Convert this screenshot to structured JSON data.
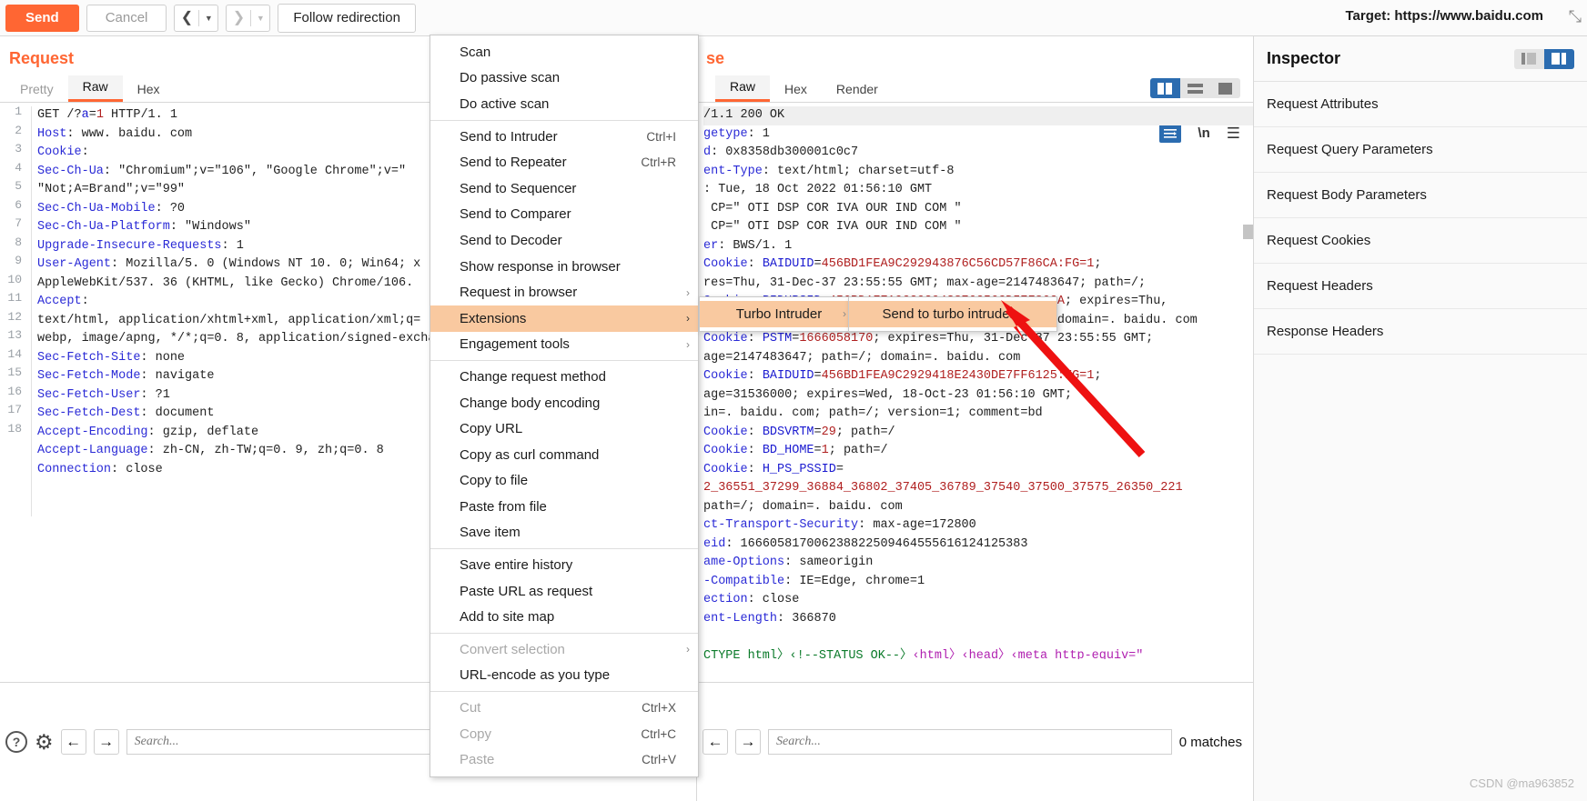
{
  "toolbar": {
    "send_label": "Send",
    "cancel_label": "Cancel",
    "back_arrow": "❮",
    "forward_arrow": "❯",
    "caret": "▼",
    "follow_redirection_label": "Follow redirection",
    "target_label": "Target: https://www.baidu.com",
    "corner_glyph": "⤡"
  },
  "request": {
    "title": "Request",
    "tabs": [
      {
        "label": "Pretty",
        "active": false,
        "muted": true
      },
      {
        "label": "Raw",
        "active": true,
        "muted": false
      },
      {
        "label": "Hex",
        "active": false,
        "muted": false
      }
    ],
    "line_numbers": [
      "1",
      "2",
      "3",
      "4",
      "",
      "5",
      "6",
      "7",
      "8",
      "",
      "9",
      "",
      "",
      "10",
      "11",
      "12",
      "13",
      "14",
      "15",
      "16",
      "17",
      "18"
    ],
    "lines": [
      {
        "n": "1",
        "segs": [
          {
            "t": "GET /?",
            "c": "v"
          },
          {
            "t": "a",
            "c": "b"
          },
          {
            "t": "=",
            "c": "v"
          },
          {
            "t": "1",
            "c": "r"
          },
          {
            "t": " HTTP/1. 1",
            "c": "v"
          }
        ]
      },
      {
        "n": "2",
        "segs": [
          {
            "t": "Host",
            "c": "k"
          },
          {
            "t": ": www. baidu. com",
            "c": "v"
          }
        ]
      },
      {
        "n": "3",
        "segs": [
          {
            "t": "Cookie",
            "c": "k"
          },
          {
            "t": ":",
            "c": "v"
          }
        ]
      },
      {
        "n": "4",
        "segs": [
          {
            "t": "Sec-Ch-Ua",
            "c": "k"
          },
          {
            "t": ": ″Chromium″;v=″106″, ″Google Chrome″;v=″",
            "c": "v"
          }
        ]
      },
      {
        "n": "",
        "segs": [
          {
            "t": "″Not;A=Brand″;v=″99″",
            "c": "v"
          }
        ]
      },
      {
        "n": "5",
        "segs": [
          {
            "t": "Sec-Ch-Ua-Mobile",
            "c": "k"
          },
          {
            "t": ": ?0",
            "c": "v"
          }
        ]
      },
      {
        "n": "6",
        "segs": [
          {
            "t": "Sec-Ch-Ua-Platform",
            "c": "k"
          },
          {
            "t": ": ″Windows″",
            "c": "v"
          }
        ]
      },
      {
        "n": "7",
        "segs": [
          {
            "t": "Upgrade-Insecure-Requests",
            "c": "k"
          },
          {
            "t": ": 1",
            "c": "v"
          }
        ]
      },
      {
        "n": "8",
        "segs": [
          {
            "t": "User-Agent",
            "c": "k"
          },
          {
            "t": ": Mozilla/5. 0 (Windows NT 10. 0; Win64; x",
            "c": "v"
          }
        ]
      },
      {
        "n": "",
        "segs": [
          {
            "t": "AppleWebKit/537. 36 (KHTML, like Gecko) Chrome/106.",
            "c": "v"
          }
        ]
      },
      {
        "n": "9",
        "segs": [
          {
            "t": "Accept",
            "c": "k"
          },
          {
            "t": ":",
            "c": "v"
          }
        ]
      },
      {
        "n": "",
        "segs": [
          {
            "t": "text/html, application/xhtml+xml, application/xml;q=",
            "c": "v"
          }
        ]
      },
      {
        "n": "",
        "segs": [
          {
            "t": "webp, image/apng, */*;q=0. 8, application/signed-excha",
            "c": "v"
          }
        ]
      },
      {
        "n": "10",
        "segs": [
          {
            "t": "Sec-Fetch-Site",
            "c": "k"
          },
          {
            "t": ": none",
            "c": "v"
          }
        ]
      },
      {
        "n": "11",
        "segs": [
          {
            "t": "Sec-Fetch-Mode",
            "c": "k"
          },
          {
            "t": ": navigate",
            "c": "v"
          }
        ]
      },
      {
        "n": "12",
        "segs": [
          {
            "t": "Sec-Fetch-User",
            "c": "k"
          },
          {
            "t": ": ?1",
            "c": "v"
          }
        ]
      },
      {
        "n": "13",
        "segs": [
          {
            "t": "Sec-Fetch-Dest",
            "c": "k"
          },
          {
            "t": ": document",
            "c": "v"
          }
        ]
      },
      {
        "n": "14",
        "segs": [
          {
            "t": "Accept-Encoding",
            "c": "k"
          },
          {
            "t": ": gzip, deflate",
            "c": "v"
          }
        ]
      },
      {
        "n": "15",
        "segs": [
          {
            "t": "Accept-Language",
            "c": "k"
          },
          {
            "t": ": zh-CN, zh-TW;q=0. 9, zh;q=0. 8",
            "c": "v"
          }
        ]
      },
      {
        "n": "16",
        "segs": [
          {
            "t": "Connection",
            "c": "k"
          },
          {
            "t": ": close",
            "c": "v"
          }
        ]
      },
      {
        "n": "17",
        "segs": []
      },
      {
        "n": "18",
        "segs": []
      }
    ]
  },
  "response": {
    "title": "se",
    "full_title": "Response",
    "tabs": [
      {
        "label": "Raw",
        "active": true
      },
      {
        "label": "Hex",
        "active": false
      },
      {
        "label": "Render",
        "active": false
      }
    ],
    "lines": [
      {
        "segs": [
          {
            "t": "/1.1 200 OK",
            "c": "v"
          }
        ],
        "hl": true
      },
      {
        "segs": [
          {
            "t": "getype",
            "c": "k"
          },
          {
            "t": ": 1",
            "c": "v"
          }
        ]
      },
      {
        "segs": [
          {
            "t": "d",
            "c": "k"
          },
          {
            "t": ": 0x8358db300001c0c7",
            "c": "v"
          }
        ]
      },
      {
        "segs": [
          {
            "t": "ent-Type",
            "c": "k"
          },
          {
            "t": ": text/html; charset=utf-8",
            "c": "v"
          }
        ]
      },
      {
        "segs": [
          {
            "t": ": Tue, 18 Oct 2022 01:56:10 GMT",
            "c": "v"
          }
        ]
      },
      {
        "segs": [
          {
            "t": " CP=″ OTI DSP COR IVA OUR IND COM ″",
            "c": "v"
          }
        ]
      },
      {
        "segs": [
          {
            "t": " CP=″ OTI DSP COR IVA OUR IND COM ″",
            "c": "v"
          }
        ]
      },
      {
        "segs": [
          {
            "t": "er",
            "c": "k"
          },
          {
            "t": ": BWS/1. 1",
            "c": "v"
          }
        ]
      },
      {
        "segs": [
          {
            "t": "Cookie",
            "c": "k"
          },
          {
            "t": ": ",
            "c": "v"
          },
          {
            "t": "BAIDUID",
            "c": "b"
          },
          {
            "t": "=",
            "c": "v"
          },
          {
            "t": "456BD1FEA9C292943876C56CD57F86CA:FG=1",
            "c": "r"
          },
          {
            "t": ";",
            "c": "v"
          }
        ]
      },
      {
        "segs": [
          {
            "t": "res=Thu, 31-Dec-37 23:55:55 GMT; max-age=2147483647; path=/;",
            "c": "v"
          }
        ]
      },
      {
        "segs": [
          {
            "t": "Cookie",
            "c": "k"
          },
          {
            "t": ": ",
            "c": "v"
          },
          {
            "t": "BIDUPSID",
            "c": "b"
          },
          {
            "t": "=",
            "c": "v"
          },
          {
            "t": "456BD1FEA9C292943876C56CD57F86CA",
            "c": "r"
          },
          {
            "t": "; expires=Thu,",
            "c": "v"
          }
        ]
      },
      {
        "segs": [
          {
            "t": "ec-37 23:55:55 GMT; max-age=2147483647; path=/; domain=. baidu. com",
            "c": "v"
          }
        ]
      },
      {
        "segs": [
          {
            "t": "Cookie",
            "c": "k"
          },
          {
            "t": ": ",
            "c": "v"
          },
          {
            "t": "PSTM",
            "c": "b"
          },
          {
            "t": "=",
            "c": "v"
          },
          {
            "t": "1666058170",
            "c": "r"
          },
          {
            "t": "; expires=Thu, 31-Dec-37 23:55:55 GMT;",
            "c": "v"
          }
        ]
      },
      {
        "segs": [
          {
            "t": "age=2147483647; path=/; domain=. baidu. com",
            "c": "v"
          }
        ]
      },
      {
        "segs": [
          {
            "t": "Cookie",
            "c": "k"
          },
          {
            "t": ": ",
            "c": "v"
          },
          {
            "t": "BAIDUID",
            "c": "b"
          },
          {
            "t": "=",
            "c": "v"
          },
          {
            "t": "456BD1FEA9C2929418E2430DE7FF6125:FG=1",
            "c": "r"
          },
          {
            "t": ";",
            "c": "v"
          }
        ]
      },
      {
        "segs": [
          {
            "t": "age=31536000; expires=Wed, 18-Oct-23 01:56:10 GMT;",
            "c": "v"
          }
        ]
      },
      {
        "segs": [
          {
            "t": "in=. baidu. com; path=/; version=1; comment=bd",
            "c": "v"
          }
        ]
      },
      {
        "segs": [
          {
            "t": "Cookie",
            "c": "k"
          },
          {
            "t": ": ",
            "c": "v"
          },
          {
            "t": "BDSVRTM",
            "c": "b"
          },
          {
            "t": "=",
            "c": "v"
          },
          {
            "t": "29",
            "c": "r"
          },
          {
            "t": "; path=/",
            "c": "v"
          }
        ]
      },
      {
        "segs": [
          {
            "t": "Cookie",
            "c": "k"
          },
          {
            "t": ": ",
            "c": "v"
          },
          {
            "t": "BD_HOME",
            "c": "b"
          },
          {
            "t": "=",
            "c": "v"
          },
          {
            "t": "1",
            "c": "r"
          },
          {
            "t": "; path=/",
            "c": "v"
          }
        ]
      },
      {
        "segs": [
          {
            "t": "Cookie",
            "c": "k"
          },
          {
            "t": ": ",
            "c": "v"
          },
          {
            "t": "H_PS_PSSID",
            "c": "b"
          },
          {
            "t": "=",
            "c": "v"
          }
        ]
      },
      {
        "segs": [
          {
            "t": "2_36551_37299_36884_36802_37405_36789_37540_37500_37575_26350_221",
            "c": "r"
          }
        ]
      },
      {
        "segs": [
          {
            "t": "path=/; domain=. baidu. com",
            "c": "v"
          }
        ]
      },
      {
        "segs": [
          {
            "t": "ct-Transport-Security",
            "c": "k"
          },
          {
            "t": ": max-age=172800",
            "c": "v"
          }
        ]
      },
      {
        "segs": [
          {
            "t": "eid",
            "c": "k"
          },
          {
            "t": ": 16660581700623882250946455561612412538",
            "c": "v"
          },
          {
            "t": "3",
            "c": "v"
          }
        ]
      },
      {
        "segs": [
          {
            "t": "ame-Options",
            "c": "k"
          },
          {
            "t": ": sameorigin",
            "c": "v"
          }
        ]
      },
      {
        "segs": [
          {
            "t": "-Compatible",
            "c": "k"
          },
          {
            "t": ": IE=Edge, chrome=1",
            "c": "v"
          }
        ]
      },
      {
        "segs": [
          {
            "t": "ection",
            "c": "k"
          },
          {
            "t": ": close",
            "c": "v"
          }
        ]
      },
      {
        "segs": [
          {
            "t": "ent-Length",
            "c": "k"
          },
          {
            "t": ": 366870",
            "c": "v"
          }
        ]
      },
      {
        "segs": []
      },
      {
        "segs": [
          {
            "t": "CTYPE html〉‹!--STATUS OK--〉",
            "c": "g"
          },
          {
            "t": "‹html〉‹head〉‹meta http-equiv=″",
            "c": "m"
          }
        ]
      }
    ],
    "view_icons": [
      "split-columns-icon",
      "split-rows-icon",
      "single-pane-icon"
    ],
    "wrap_icon": "word-wrap-icon",
    "newline_label": "\\n",
    "menu_icon": "hamburger-icon"
  },
  "context_menu": {
    "items": [
      {
        "label": "Scan",
        "accel": "",
        "sub": false,
        "disabled": false,
        "hl": false
      },
      {
        "label": "Do passive scan",
        "accel": "",
        "sub": false,
        "disabled": false,
        "hl": false
      },
      {
        "label": "Do active scan",
        "accel": "",
        "sub": false,
        "disabled": false,
        "hl": false
      },
      {
        "sep": true
      },
      {
        "label": "Send to Intruder",
        "accel": "Ctrl+I",
        "sub": false,
        "disabled": false,
        "hl": false
      },
      {
        "label": "Send to Repeater",
        "accel": "Ctrl+R",
        "sub": false,
        "disabled": false,
        "hl": false
      },
      {
        "label": "Send to Sequencer",
        "accel": "",
        "sub": false,
        "disabled": false,
        "hl": false
      },
      {
        "label": "Send to Comparer",
        "accel": "",
        "sub": false,
        "disabled": false,
        "hl": false
      },
      {
        "label": "Send to Decoder",
        "accel": "",
        "sub": false,
        "disabled": false,
        "hl": false
      },
      {
        "label": "Show response in browser",
        "accel": "",
        "sub": false,
        "disabled": false,
        "hl": false
      },
      {
        "label": "Request in browser",
        "accel": "",
        "sub": true,
        "disabled": false,
        "hl": false
      },
      {
        "label": "Extensions",
        "accel": "",
        "sub": true,
        "disabled": false,
        "hl": true
      },
      {
        "label": "Engagement tools",
        "accel": "",
        "sub": true,
        "disabled": false,
        "hl": false
      },
      {
        "sep": true
      },
      {
        "label": "Change request method",
        "accel": "",
        "sub": false,
        "disabled": false,
        "hl": false
      },
      {
        "label": "Change body encoding",
        "accel": "",
        "sub": false,
        "disabled": false,
        "hl": false
      },
      {
        "label": "Copy URL",
        "accel": "",
        "sub": false,
        "disabled": false,
        "hl": false
      },
      {
        "label": "Copy as curl command",
        "accel": "",
        "sub": false,
        "disabled": false,
        "hl": false
      },
      {
        "label": "Copy to file",
        "accel": "",
        "sub": false,
        "disabled": false,
        "hl": false
      },
      {
        "label": "Paste from file",
        "accel": "",
        "sub": false,
        "disabled": false,
        "hl": false
      },
      {
        "label": "Save item",
        "accel": "",
        "sub": false,
        "disabled": false,
        "hl": false
      },
      {
        "sep": true
      },
      {
        "label": "Save entire history",
        "accel": "",
        "sub": false,
        "disabled": false,
        "hl": false
      },
      {
        "label": "Paste URL as request",
        "accel": "",
        "sub": false,
        "disabled": false,
        "hl": false
      },
      {
        "label": "Add to site map",
        "accel": "",
        "sub": false,
        "disabled": false,
        "hl": false
      },
      {
        "sep": true
      },
      {
        "label": "Convert selection",
        "accel": "",
        "sub": true,
        "disabled": true,
        "hl": false
      },
      {
        "label": "URL-encode as you type",
        "accel": "",
        "sub": false,
        "disabled": false,
        "hl": false
      },
      {
        "sep": true
      },
      {
        "label": "Cut",
        "accel": "Ctrl+X",
        "sub": false,
        "disabled": true,
        "hl": false
      },
      {
        "label": "Copy",
        "accel": "Ctrl+C",
        "sub": false,
        "disabled": true,
        "hl": false
      },
      {
        "label": "Paste",
        "accel": "Ctrl+V",
        "sub": false,
        "disabled": true,
        "hl": false
      }
    ]
  },
  "submenu_extensions": {
    "items": [
      {
        "label": "Turbo Intruder",
        "sub": true
      }
    ]
  },
  "submenu_turbo": {
    "items": [
      {
        "label": "Send to turbo intruder",
        "sub": false
      }
    ]
  },
  "inspector": {
    "title": "Inspector",
    "rows": [
      "Request Attributes",
      "Request Query Parameters",
      "Request Body Parameters",
      "Request Cookies",
      "Request Headers",
      "Response Headers"
    ]
  },
  "bottom_left": {
    "help_glyph": "?",
    "gear_glyph": "⚙",
    "prev_glyph": "←",
    "next_glyph": "→",
    "search_placeholder": "Search..."
  },
  "bottom_right": {
    "prev_glyph": "←",
    "next_glyph": "→",
    "search_placeholder": "Search...",
    "matches_label": "0 matches"
  },
  "watermark": "CSDN @ma963852",
  "colors": {
    "accent_orange": "#ff6633",
    "menu_highlight": "#f9c9a0",
    "select_blue": "#2b6cb0",
    "annotation_red": "#ee1111"
  }
}
